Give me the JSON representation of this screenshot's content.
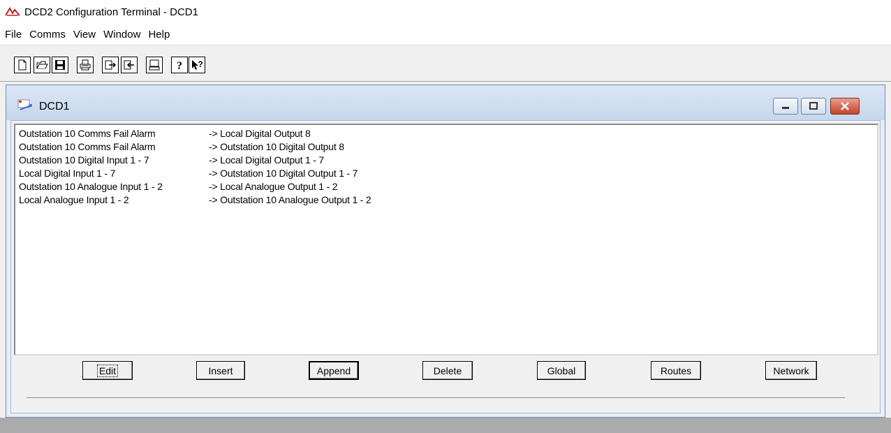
{
  "app": {
    "title": "DCD2 Configuration Terminal - DCD1"
  },
  "menu": [
    "File",
    "Comms",
    "View",
    "Window",
    "Help"
  ],
  "toolbar": {
    "icons": [
      "new-file-icon",
      "open-folder-icon",
      "save-icon",
      "print-icon",
      "export-icon",
      "import-icon",
      "terminal-icon",
      "help-icon",
      "context-help-icon"
    ]
  },
  "child": {
    "title": "DCD1",
    "rows": [
      {
        "source": "Outstation 10 Comms Fail Alarm",
        "target": "-> Local Digital Output 8"
      },
      {
        "source": "Outstation 10 Comms Fail Alarm",
        "target": "-> Outstation 10 Digital Output 8"
      },
      {
        "source": "Outstation 10 Digital Input 1 - 7",
        "target": "-> Local Digital Output 1 - 7"
      },
      {
        "source": "Local Digital Input 1 - 7",
        "target": "-> Outstation 10 Digital Output 1 - 7"
      },
      {
        "source": "Outstation 10 Analogue Input 1 - 2",
        "target": "-> Local Analogue Output 1 - 2"
      },
      {
        "source": "Local Analogue Input 1 - 2",
        "target": "-> Outstation 10 Analogue Output 1 - 2"
      }
    ],
    "buttons": {
      "edit": "Edit",
      "insert": "Insert",
      "append": "Append",
      "delete": "Delete",
      "global": "Global",
      "routes": "Routes",
      "network": "Network"
    }
  }
}
